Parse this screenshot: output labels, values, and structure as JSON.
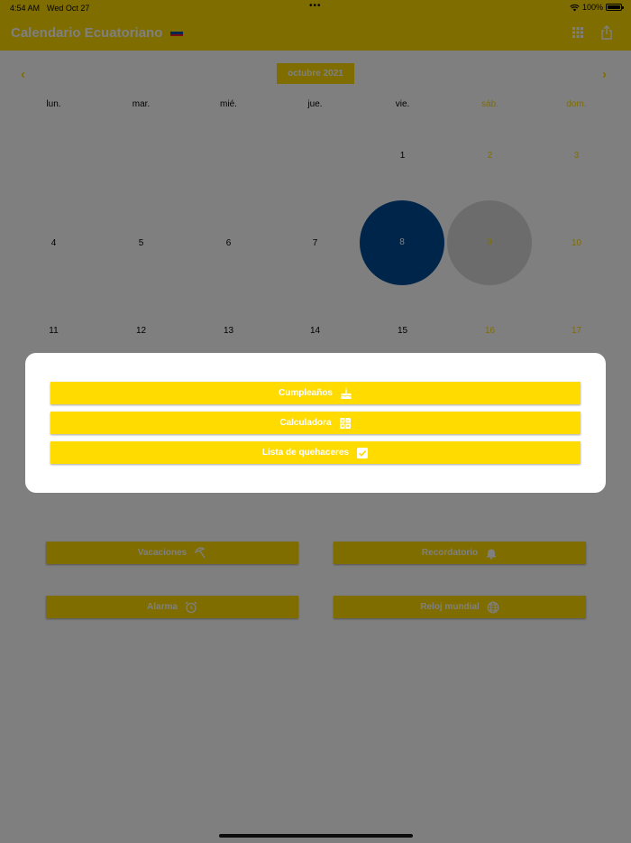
{
  "status_bar": {
    "time": "4:54 AM",
    "date": "Wed Oct 27",
    "battery": "100%",
    "icons": [
      "wifi-icon",
      "battery-icon"
    ]
  },
  "nav_bar": {
    "title": "Calendario Ecuatoriano",
    "icons": [
      "ecuador-flag-icon",
      "grid-menu-icon",
      "share-icon"
    ]
  },
  "calendar": {
    "month_label": "octubre 2021",
    "prev_icon": "‹",
    "next_icon": "›",
    "weekdays": [
      "lun.",
      "mar.",
      "mié.",
      "jue.",
      "vie.",
      "sáb.",
      "dom."
    ],
    "weeks": [
      [
        "",
        "",
        "",
        "",
        "1",
        "2",
        "3"
      ],
      [
        "4",
        "5",
        "6",
        "7",
        "8",
        "9",
        "10"
      ],
      [
        "11",
        "12",
        "13",
        "14",
        "15",
        "16",
        "17"
      ]
    ],
    "highlighted_days": [
      {
        "day": "8",
        "color": "#004B96"
      },
      {
        "day": "9",
        "color": "#D9D9D9"
      }
    ]
  },
  "bottom_buttons": {
    "vacaciones": "Vacaciones",
    "recordatorio": "Recordatorio",
    "alarma": "Alarma",
    "reloj_mundial": "Reloj mundial"
  },
  "modal": {
    "cumpleanos": "Cumpleaños",
    "calculadora": "Calculadora",
    "lista": "Lista de quehaceres"
  },
  "colors": {
    "accent": "#FFDB00",
    "selected_day": "#004B96",
    "secondary_day": "#D9D9D9",
    "overlay": "rgba(0,0,0,0.5)"
  }
}
